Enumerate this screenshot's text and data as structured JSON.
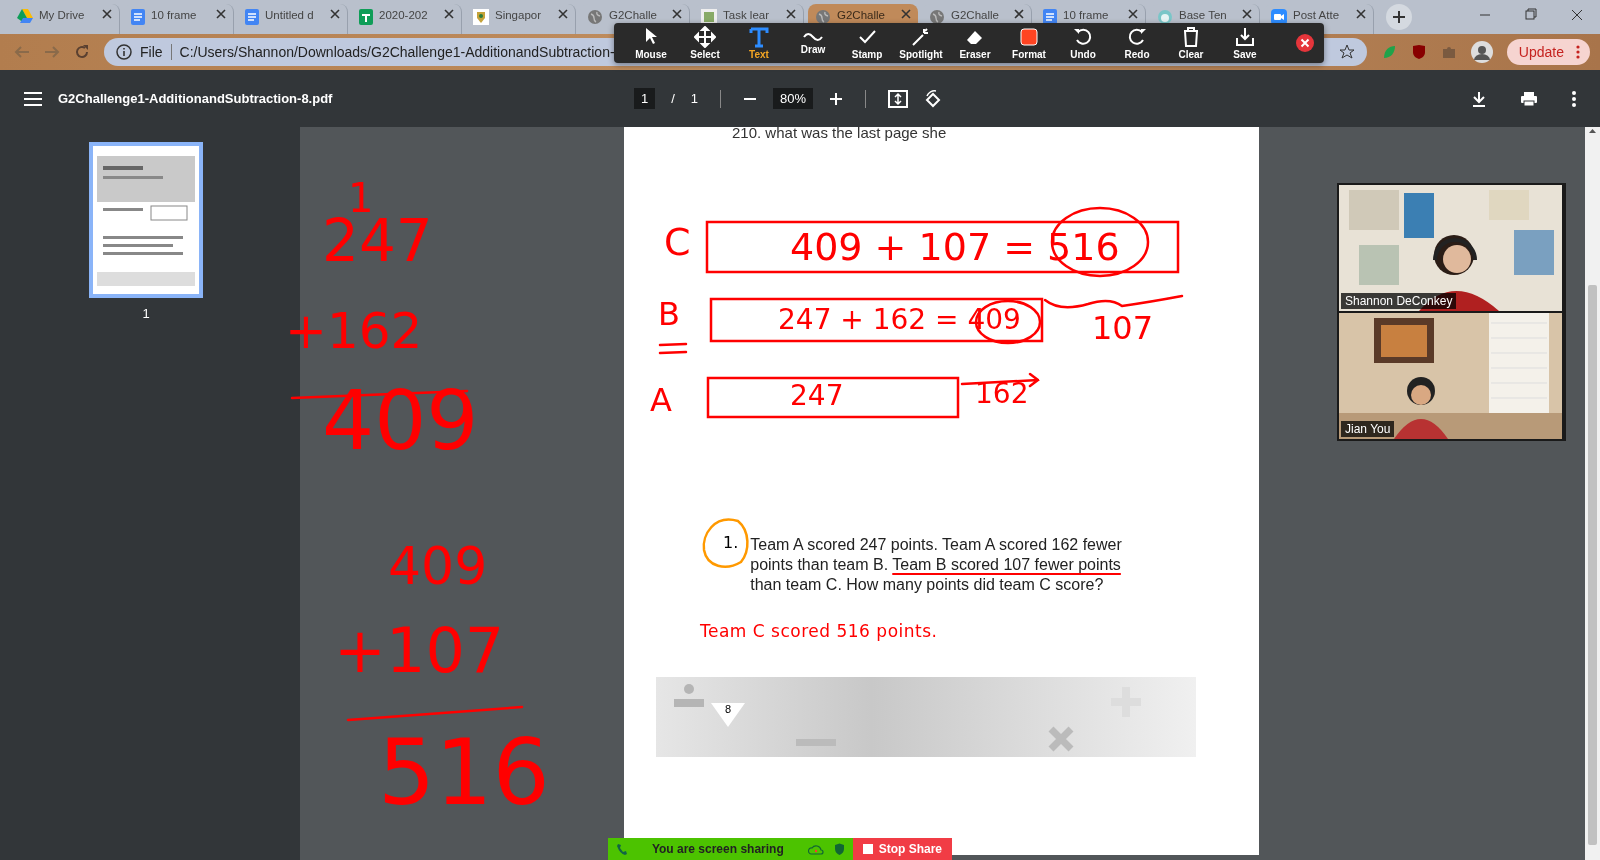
{
  "browser": {
    "tabs": [
      {
        "label": "My Drive",
        "selected": false
      },
      {
        "label": "10 frame",
        "selected": false
      },
      {
        "label": "Untitled d",
        "selected": false
      },
      {
        "label": "2020-202",
        "selected": false
      },
      {
        "label": "Singapor",
        "selected": false
      },
      {
        "label": "G2Challe",
        "selected": false
      },
      {
        "label": "Task lear",
        "selected": false
      },
      {
        "label": "G2Challe",
        "selected": true
      },
      {
        "label": "G2Challe",
        "selected": false
      },
      {
        "label": "10 frame",
        "selected": false
      },
      {
        "label": "Base Ten",
        "selected": false
      },
      {
        "label": "Post Atte",
        "selected": false
      }
    ],
    "address": {
      "scheme": "File",
      "url": "C:/Users/Shannon/Downloads/G2Challenge1-AdditionandSubtraction-"
    },
    "update_button": "Update"
  },
  "zoom_toolbar": {
    "tools": [
      {
        "label": "Mouse",
        "selected": false
      },
      {
        "label": "Select",
        "selected": false
      },
      {
        "label": "Text",
        "selected": true
      },
      {
        "label": "Draw",
        "selected": false
      },
      {
        "label": "Stamp",
        "selected": false
      },
      {
        "label": "Spotlight",
        "selected": false
      },
      {
        "label": "Eraser",
        "selected": false
      },
      {
        "label": "Format",
        "selected": false
      },
      {
        "label": "Undo",
        "selected": false
      },
      {
        "label": "Redo",
        "selected": false
      },
      {
        "label": "Clear",
        "selected": false
      },
      {
        "label": "Save",
        "selected": false
      }
    ]
  },
  "pdf": {
    "title": "G2Challenge1-AdditionandSubtraction-8.pdf",
    "page": "1",
    "page_separator": "/",
    "page_count": "1",
    "zoom": "80%",
    "thumbnails": [
      {
        "label": "1",
        "selected": true
      }
    ],
    "top_text": "210. what was the last page she",
    "handwriting": [
      {
        "text": "1"
      },
      {
        "text": "247"
      },
      {
        "text": "+162"
      },
      {
        "text": "409"
      },
      {
        "text": "409"
      },
      {
        "text": "+107"
      },
      {
        "text": "516"
      },
      {
        "text": "C"
      },
      {
        "text": "409 + 107 = 516"
      },
      {
        "text": "B"
      },
      {
        "text": "247 + 162 = 409"
      },
      {
        "text": "107"
      },
      {
        "text": "A"
      },
      {
        "text": "247"
      },
      {
        "text": "162"
      }
    ],
    "problem": {
      "number": "1.",
      "segments": [
        {
          "text": "Team A scored 247 points. Team A scored 162 fewer points than team B. ",
          "underlined": false
        },
        {
          "text": "Team B scored 107 fewer points",
          "underlined": true
        },
        {
          "text": " than team C. How many points did team C score?",
          "underlined": false
        }
      ]
    },
    "answer": "Team C scored 516 points.",
    "footer_page": "8"
  },
  "participants": [
    {
      "name": "Shannon DeConkey"
    },
    {
      "name": "Jian You"
    }
  ],
  "share_bar": {
    "status": "You are screen sharing",
    "stop_button": "Stop Share"
  }
}
